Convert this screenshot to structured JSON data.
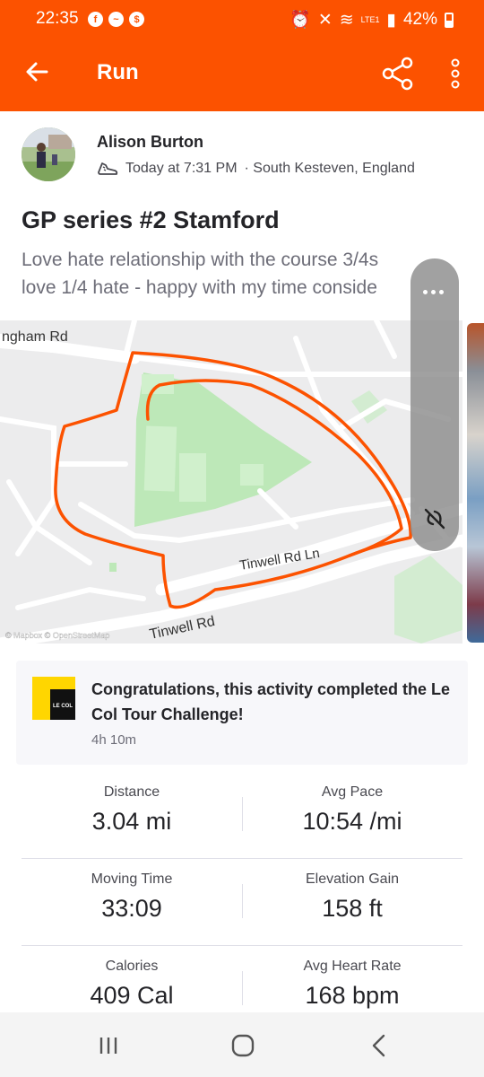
{
  "status_bar": {
    "time": "22:35",
    "left_icons": [
      "facebook-icon",
      "messenger-icon",
      "money-icon"
    ],
    "network": "LTE1",
    "battery": "42%"
  },
  "app_bar": {
    "title": "Run",
    "color": "#fc5200",
    "icons": [
      "back-arrow-icon",
      "share-icon",
      "more-vertical-icon"
    ]
  },
  "activity": {
    "athlete_name": "Alison Burton",
    "timestamp": "Today at 7:31 PM",
    "location": "· South Kesteven, England",
    "title": "GP series #2 Stamford",
    "description_line1": "Love hate relationship with the course 3/4s",
    "description_line2": "love 1/4 hate - happy with my time conside"
  },
  "map": {
    "road_labels": [
      "ngham Rd",
      "Tinwell Rd Ln",
      "Tinwell Rd"
    ],
    "attribution": "© Mapbox © OpenStreetMap",
    "route_color": "#fc5200",
    "park_color": "#bde8b8"
  },
  "challenge": {
    "text": "Congratulations, this activity completed the Le Col Tour Challenge!",
    "time": "4h 10m",
    "logo_text": "LE COL"
  },
  "stats": [
    {
      "left": {
        "label": "Distance",
        "value": "3.04 mi"
      },
      "right": {
        "label": "Avg Pace",
        "value": "10:54 /mi"
      }
    },
    {
      "left": {
        "label": "Moving Time",
        "value": "33:09"
      },
      "right": {
        "label": "Elevation Gain",
        "value": "158 ft"
      }
    },
    {
      "left": {
        "label": "Calories",
        "value": "409 Cal"
      },
      "right": {
        "label": "Avg Heart Rate",
        "value": "168 bpm"
      }
    }
  ],
  "nav_bar": {
    "icons": [
      "recents-icon",
      "home-icon",
      "back-icon"
    ]
  }
}
